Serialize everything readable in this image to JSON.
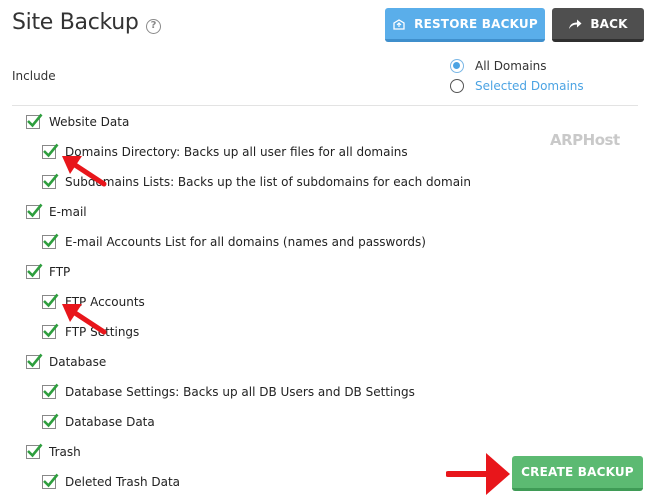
{
  "header": {
    "title": "Site Backup",
    "help_glyph": "?",
    "restore_label": "RESTORE BACKUP",
    "back_label": "BACK"
  },
  "include": {
    "label": "Include",
    "options": [
      {
        "label": "All Domains",
        "selected": true
      },
      {
        "label": "Selected Domains",
        "selected": false
      }
    ]
  },
  "watermark": "ARPHost",
  "sections": [
    {
      "label": "Website Data",
      "checked": true,
      "items": [
        {
          "label": "Domains Directory: Backs up all user files for all domains",
          "checked": true
        },
        {
          "label": "Subdomains Lists: Backs up the list of subdomains for each domain",
          "checked": true
        }
      ]
    },
    {
      "label": "E-mail",
      "checked": true,
      "items": [
        {
          "label": "E-mail Accounts List for all domains (names and passwords)",
          "checked": true
        }
      ]
    },
    {
      "label": "FTP",
      "checked": true,
      "items": [
        {
          "label": "FTP Accounts",
          "checked": true
        },
        {
          "label": "FTP Settings",
          "checked": true
        }
      ]
    },
    {
      "label": "Database",
      "checked": true,
      "items": [
        {
          "label": "Database Settings: Backs up all DB Users and DB Settings",
          "checked": true
        },
        {
          "label": "Database Data",
          "checked": true
        }
      ]
    },
    {
      "label": "Trash",
      "checked": true,
      "items": [
        {
          "label": "Deleted Trash Data",
          "checked": true
        }
      ]
    }
  ],
  "create_label": "CREATE BACKUP",
  "colors": {
    "accent_blue": "#5aaeea",
    "dark_button": "#4f4f4f",
    "create_green": "#5cba72",
    "checkmark_green": "#2e9e3e",
    "arrow_red": "#e8161b"
  }
}
